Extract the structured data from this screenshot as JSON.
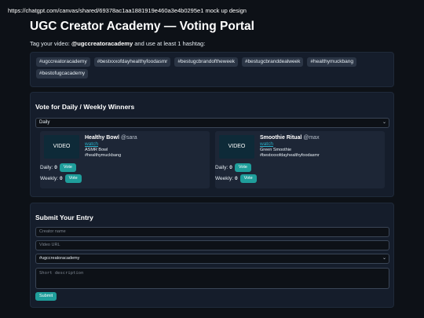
{
  "browser": {
    "url_text": "https://chatgpt.com/canvas/shared/69378ac1aa1881919e460a3e4b0295e1 mock up design"
  },
  "page": {
    "title": "UGC Creator Academy — Voting Portal",
    "tag_prefix": "Tag your video: ",
    "tag_handle": "@ugccreatoracademy",
    "tag_suffix": " and use at least 1 hashtag:"
  },
  "hashtags": [
    "#ugccreatoracademy",
    "#bestxxxofdayhealthyfoodasmr",
    "#bestugcbrandoftheweek",
    "#bestugcbranddealweek",
    "#healthymuckbang",
    "#bestofugcacademy"
  ],
  "vote": {
    "heading": "Vote for Daily / Weekly Winners",
    "period_selected": "Daily",
    "daily_label": "Daily:",
    "weekly_label": "Weekly:",
    "vote_label": "Vote",
    "video_label": "VIDEO",
    "watch_label": "watch",
    "entries": [
      {
        "name": "Healthy Bowl",
        "user": "@sara",
        "subtitle": "ASMR Bowl",
        "hashtag": "#healthymuckbang",
        "daily": "0",
        "weekly": "0"
      },
      {
        "name": "Smoothie Ritual",
        "user": "@max",
        "subtitle": "Green Smoothie",
        "hashtag": "#bestxxxofdayhealthyfoodasmr",
        "daily": "0",
        "weekly": "0"
      }
    ]
  },
  "submit": {
    "heading": "Submit Your Entry",
    "creator_placeholder": "Creator name",
    "url_placeholder": "Video URL",
    "hashtag_selected": "#ugccreatoracademy",
    "description_placeholder": "Short description",
    "button_label": "Submit"
  },
  "colors": {
    "background": "#0d1117",
    "panel": "#151d2b",
    "accent": "#1f9e9b",
    "link": "#2ab0c8"
  }
}
